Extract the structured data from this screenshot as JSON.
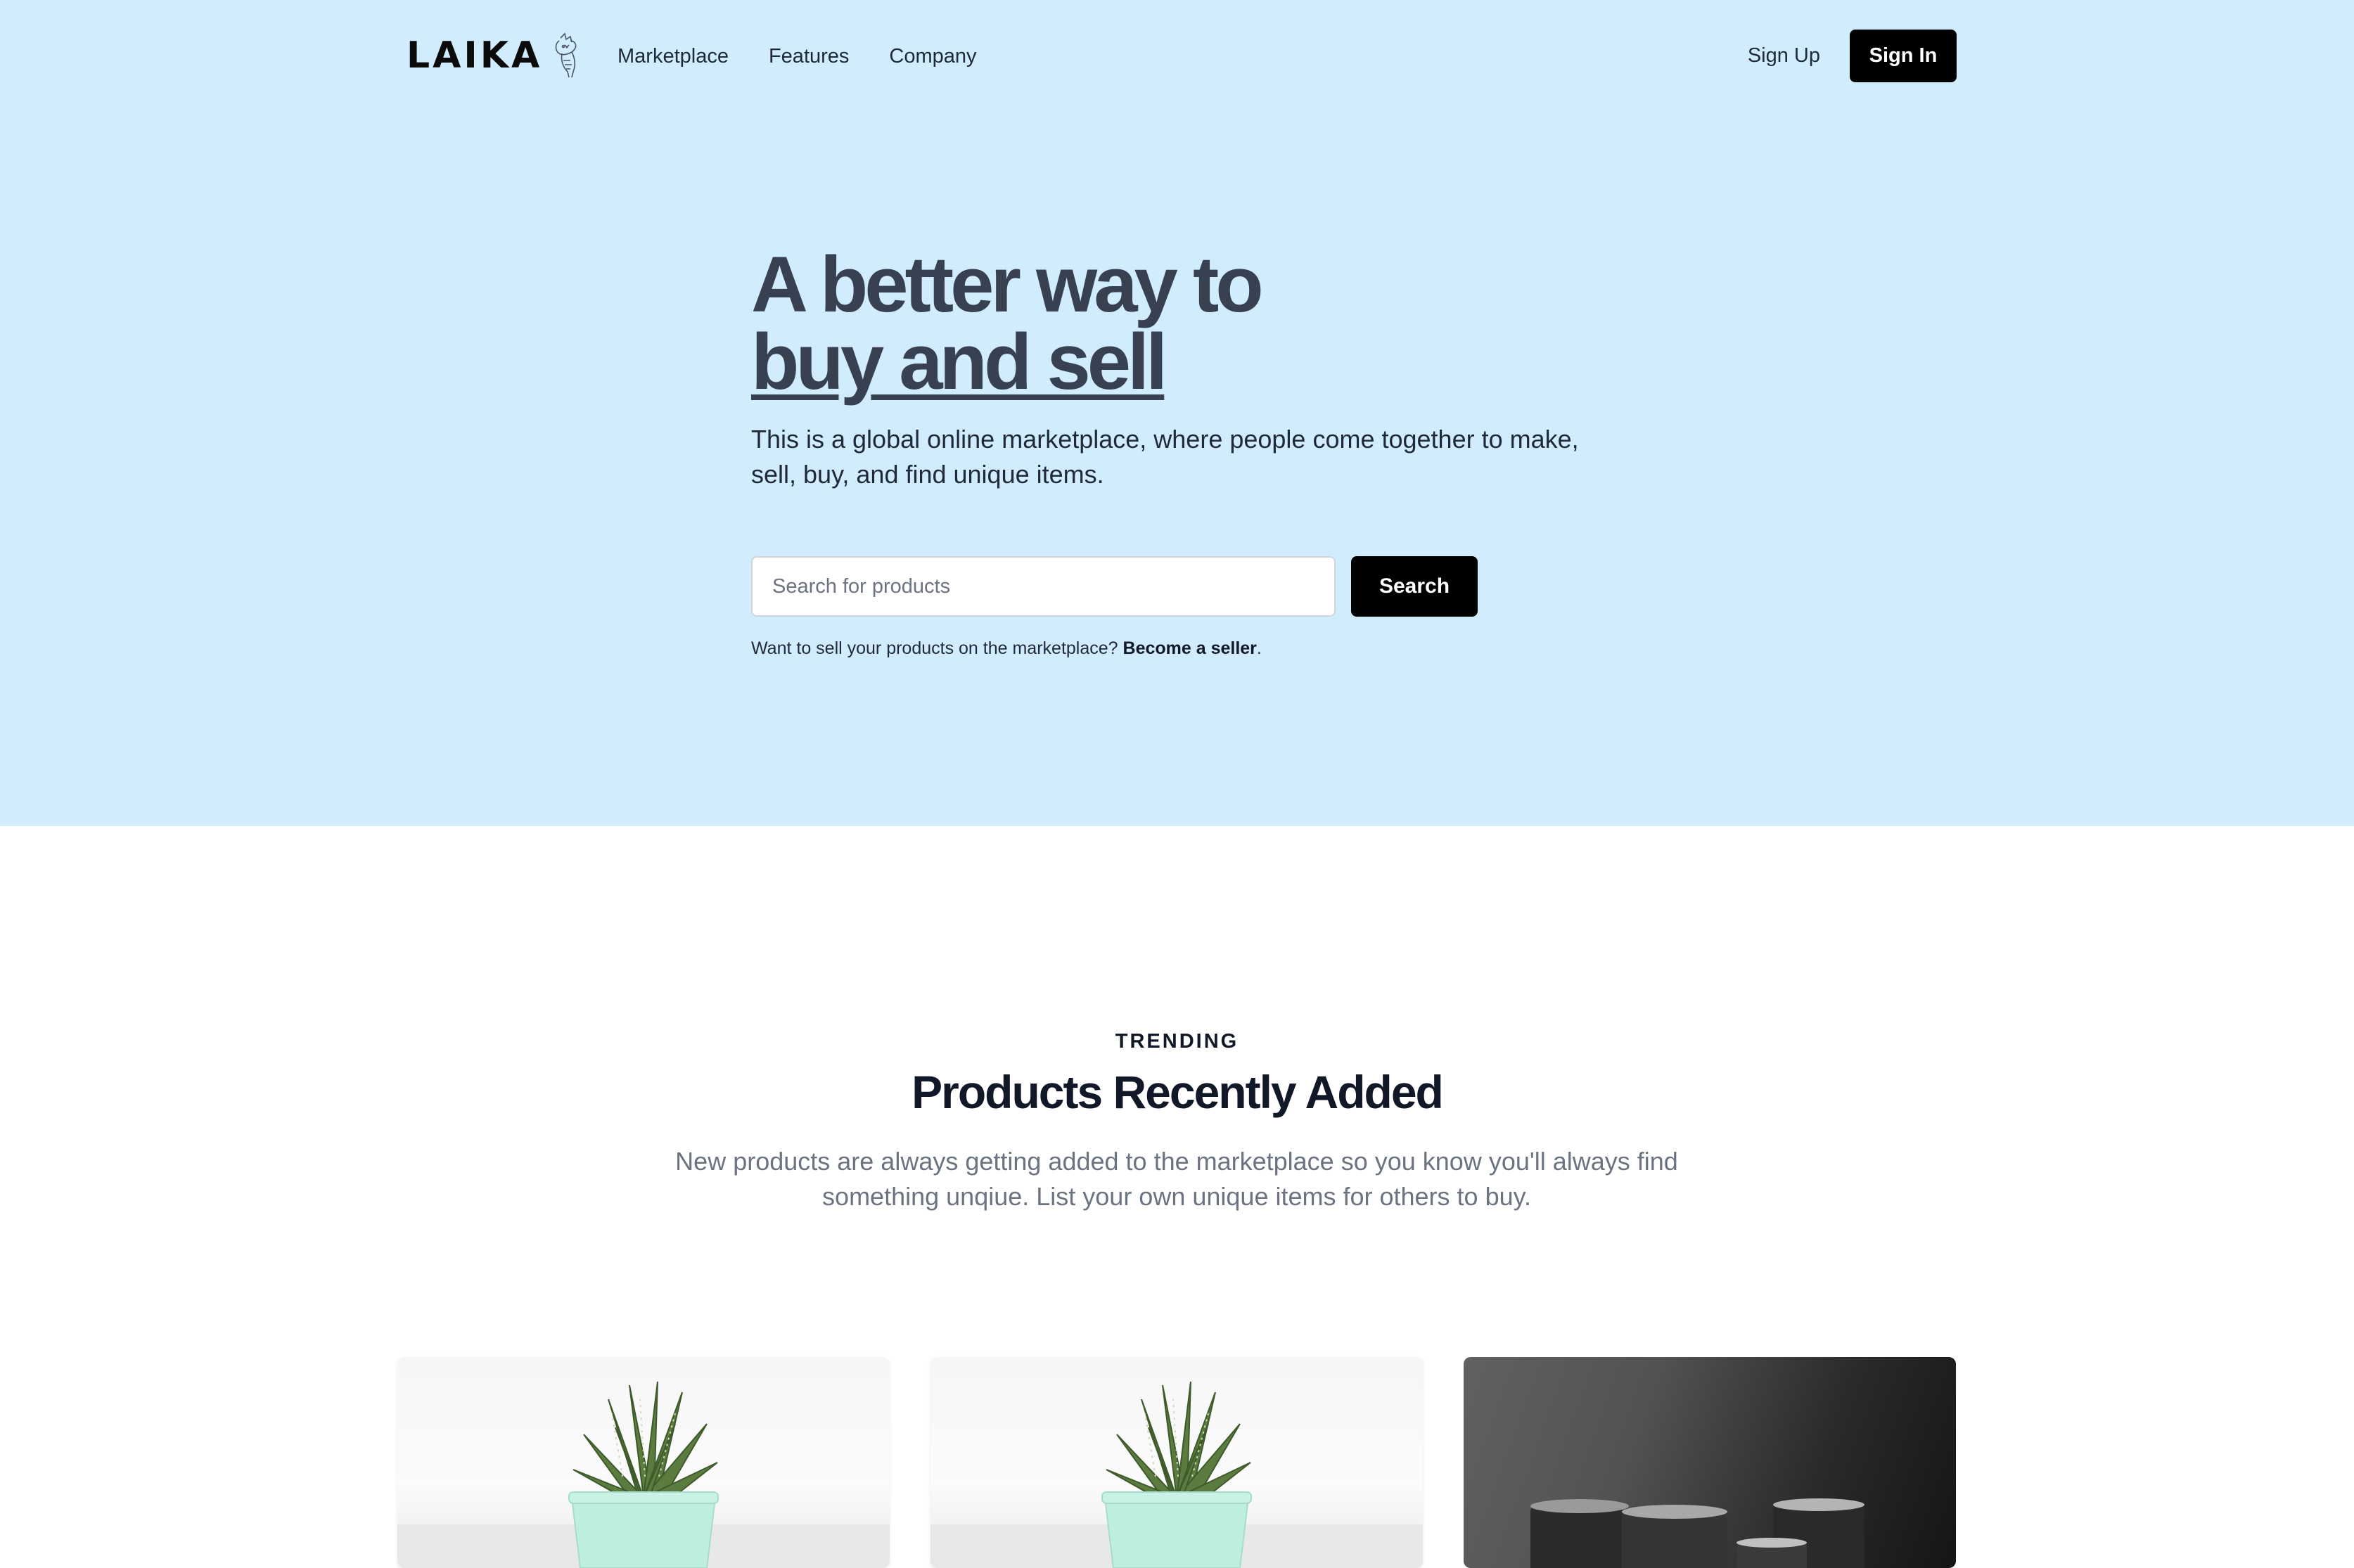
{
  "nav": {
    "logo_text": "LAIKA",
    "links": [
      "Marketplace",
      "Features",
      "Company"
    ],
    "signup_label": "Sign Up",
    "signin_label": "Sign In"
  },
  "hero": {
    "headline_line1": "A better way to",
    "headline_line2": "buy and sell",
    "subtext": "This is a global online marketplace, where people come together to make, sell, buy, and find unique items.",
    "search": {
      "placeholder": "Search for products",
      "value": "",
      "button_label": "Search"
    },
    "seller_note_prefix": "Want to sell your products on the marketplace? ",
    "seller_link": "Become a seller",
    "seller_note_suffix": "."
  },
  "trending": {
    "eyebrow": "TRENDING",
    "title": "Products Recently Added",
    "description": "New products are always getting added to the marketplace so you know you'll always find something unqiue. List your own unique items for others to buy."
  },
  "products": [
    {
      "image": "succulent-in-mint-pot"
    },
    {
      "image": "succulent-in-mint-pot"
    },
    {
      "image": "dark-ceramic-cups"
    }
  ],
  "colors": {
    "hero_background": "#d1ecfd",
    "primary_button": "#000000",
    "heading_text": "#374151",
    "muted_text": "#6b7280"
  }
}
